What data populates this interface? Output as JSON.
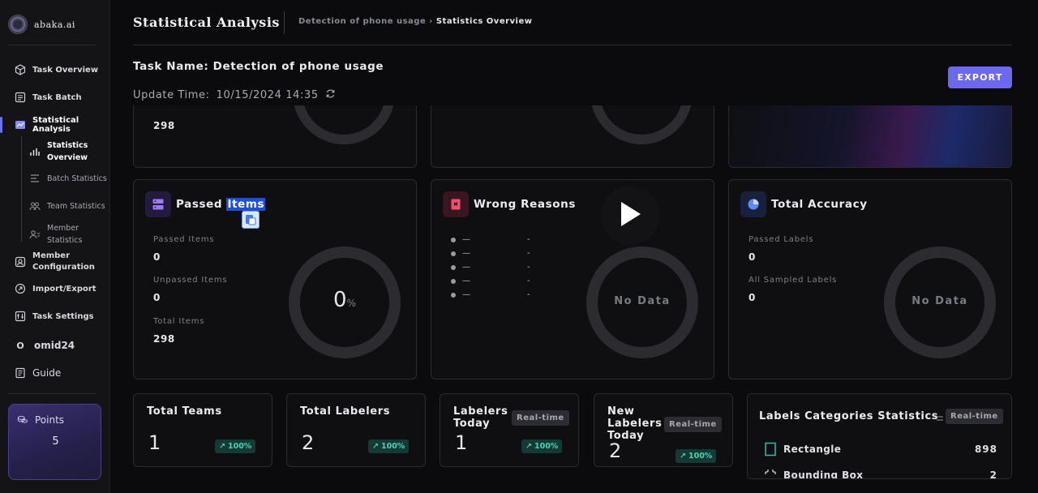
{
  "brand": {
    "name": "abaka.ai"
  },
  "sidebar": {
    "nav": [
      {
        "label": "Task Overview",
        "icon": "cube-icon"
      },
      {
        "label": "Task Batch",
        "icon": "list-icon"
      },
      {
        "label": "Statistical Analysis",
        "icon": "chart-icon"
      }
    ],
    "sub": [
      {
        "label": "Statistics Overview",
        "icon": "bar-chart-icon"
      },
      {
        "label": "Batch Statistics",
        "icon": "batch-icon"
      },
      {
        "label": "Team Statistics",
        "icon": "team-icon"
      },
      {
        "label": "Member Statistics",
        "icon": "member-icon"
      }
    ],
    "nav2": [
      {
        "label": "Member Configuration",
        "icon": "member-config-icon"
      },
      {
        "label": "Import/Export",
        "icon": "import-export-icon"
      },
      {
        "label": "Task Settings",
        "icon": "settings-icon"
      }
    ],
    "user": {
      "initial": "O",
      "name": "omid24"
    },
    "guide": "Guide",
    "points": {
      "label": "Points",
      "value": "5"
    }
  },
  "header": {
    "title": "Statistical Analysis",
    "breadcrumb_parent": "Detection of phone usage",
    "breadcrumb_sep": "›",
    "breadcrumb_current": "Statistics Overview"
  },
  "task": {
    "name_label": "Task Name:",
    "name": "Detection of phone usage",
    "update_label": "Update Time:",
    "update_time": "10/15/2024 14:35"
  },
  "export_label": "EXPORT",
  "top_row": {
    "first_value": "298"
  },
  "passed_items": {
    "title_prefix": "Passed",
    "title_highlight": "Items",
    "passed_label": "Passed Items",
    "passed_value": "0",
    "unpassed_label": "Unpassed Items",
    "unpassed_value": "0",
    "total_label": "Total Items",
    "total_value": "298",
    "percent": "0",
    "percent_unit": "%"
  },
  "wrong_reasons": {
    "title": "Wrong Reasons",
    "rows": [
      {
        "name": "—",
        "value": "-"
      },
      {
        "name": "—",
        "value": "-"
      },
      {
        "name": "—",
        "value": "-"
      },
      {
        "name": "—",
        "value": "-"
      },
      {
        "name": "—",
        "value": "-"
      }
    ],
    "no_data": "No Data"
  },
  "total_accuracy": {
    "title": "Total Accuracy",
    "passed_label": "Passed Labels",
    "passed_value": "0",
    "sampled_label": "All Sampled Labels",
    "sampled_value": "0",
    "no_data": "No Data"
  },
  "bottom": {
    "total_teams": {
      "title": "Total Teams",
      "value": "1",
      "trend": "100%"
    },
    "total_labelers": {
      "title": "Total Labelers",
      "value": "2",
      "trend": "100%"
    },
    "labelers_today": {
      "title_line1": "Labelers",
      "title_line2": "Today",
      "badge": "Real-time",
      "value": "1",
      "trend": "100%"
    },
    "new_labelers": {
      "title_line1": "New",
      "title_line2": "Labelers",
      "title_line3": "Today",
      "badge": "Real-time",
      "value": "2",
      "trend": "100%"
    }
  },
  "labels_categories": {
    "title": "Labels Categories Statistics",
    "badge": "Real-time",
    "rows": [
      {
        "name": "Rectangle",
        "count": "898",
        "icon": "rectangle-icon"
      },
      {
        "name": "Bounding Box",
        "count": "2",
        "icon": "bounding-box-icon"
      }
    ]
  },
  "colors": {
    "accent": "#6c68f0",
    "trend": "#4fd1b5",
    "highlight": "#1d4fd8"
  }
}
